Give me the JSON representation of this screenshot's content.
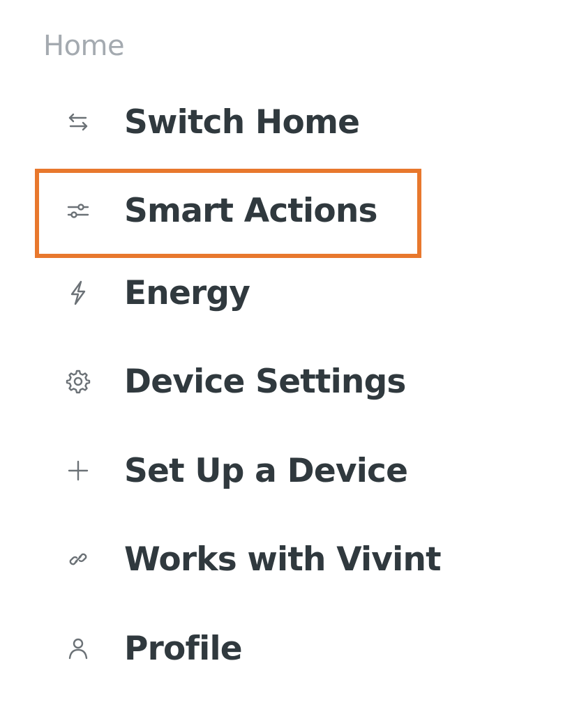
{
  "sidebar": {
    "section_title": "Home",
    "highlight_color": "#e8782d",
    "items": [
      {
        "label": "Switch Home",
        "icon": "switch-arrows-icon"
      },
      {
        "label": "Smart Actions",
        "icon": "sliders-icon",
        "highlighted": true
      },
      {
        "label": "Energy",
        "icon": "lightning-icon"
      },
      {
        "label": "Device Settings",
        "icon": "gear-icon"
      },
      {
        "label": "Set Up a Device",
        "icon": "plus-icon"
      },
      {
        "label": "Works with Vivint",
        "icon": "link-icon"
      },
      {
        "label": "Profile",
        "icon": "person-icon"
      }
    ]
  }
}
